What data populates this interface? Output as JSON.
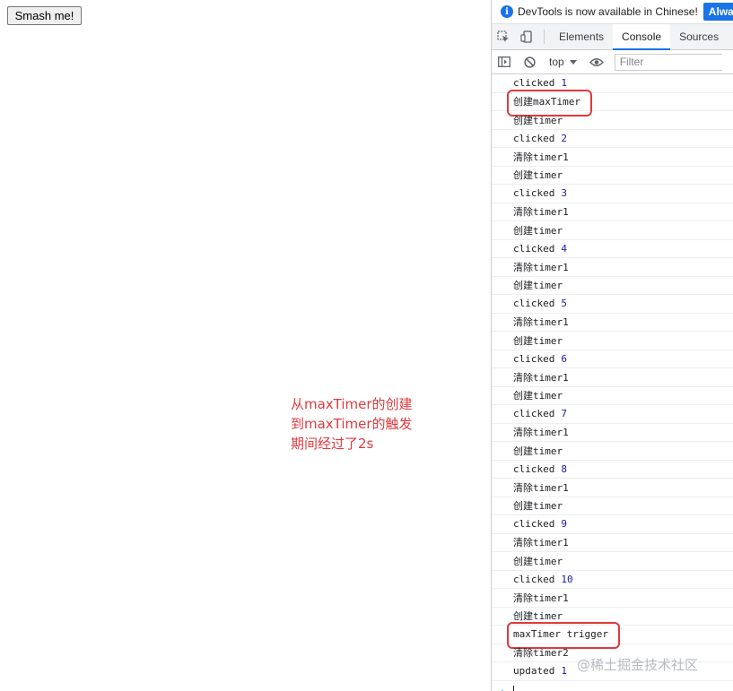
{
  "page": {
    "button_label": "Smash me!",
    "note_lines": [
      "从maxTimer的创建",
      "到maxTimer的触发",
      "期间经过了2s"
    ],
    "watermark": "@稀土掘金技术社区"
  },
  "devtools": {
    "infobar": {
      "text": "DevTools is now available in Chinese!",
      "button": "Always"
    },
    "tabs": [
      {
        "label": "Elements",
        "active": false
      },
      {
        "label": "Console",
        "active": true
      },
      {
        "label": "Sources",
        "active": false
      }
    ],
    "toolbar": {
      "context": "top",
      "filter_placeholder": "Filter"
    },
    "console_lines": [
      {
        "text": "clicked",
        "num": "1"
      },
      {
        "text": "创建maxTimer",
        "highlighted": true
      },
      {
        "text": "创建timer"
      },
      {
        "text": "clicked",
        "num": "2"
      },
      {
        "text": "清除timer1"
      },
      {
        "text": "创建timer"
      },
      {
        "text": "clicked",
        "num": "3"
      },
      {
        "text": "清除timer1"
      },
      {
        "text": "创建timer"
      },
      {
        "text": "clicked",
        "num": "4"
      },
      {
        "text": "清除timer1"
      },
      {
        "text": "创建timer"
      },
      {
        "text": "clicked",
        "num": "5"
      },
      {
        "text": "清除timer1"
      },
      {
        "text": "创建timer"
      },
      {
        "text": "clicked",
        "num": "6"
      },
      {
        "text": "清除timer1"
      },
      {
        "text": "创建timer"
      },
      {
        "text": "clicked",
        "num": "7"
      },
      {
        "text": "清除timer1"
      },
      {
        "text": "创建timer"
      },
      {
        "text": "clicked",
        "num": "8"
      },
      {
        "text": "清除timer1"
      },
      {
        "text": "创建timer"
      },
      {
        "text": "clicked",
        "num": "9"
      },
      {
        "text": "清除timer1"
      },
      {
        "text": "创建timer"
      },
      {
        "text": "clicked",
        "num": "10"
      },
      {
        "text": "清除timer1"
      },
      {
        "text": "创建timer"
      },
      {
        "text": "maxTimer trigger",
        "highlighted": true
      },
      {
        "text": "清除timer2"
      },
      {
        "text": "updated",
        "num": "1"
      }
    ],
    "icons": [
      "info-icon",
      "inspect-element-icon",
      "device-toggle-icon",
      "sidebar-toggle-icon",
      "clear-console-icon",
      "eye-icon",
      "prompt-chevron-icon"
    ],
    "colors": {
      "accent": "#1a73e8",
      "annotation": "#e0393e",
      "number": "#1a1aa6"
    }
  }
}
